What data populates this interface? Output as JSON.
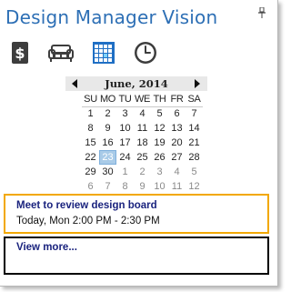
{
  "app": {
    "title": "Design Manager Vision"
  },
  "toolbar": {
    "buttons": [
      {
        "icon": "dollar-icon"
      },
      {
        "icon": "sofa-icon"
      },
      {
        "icon": "calendar-grid-icon"
      },
      {
        "icon": "clock-icon"
      }
    ]
  },
  "calendar": {
    "month_label": "June, 2014",
    "weekdays": [
      "SU",
      "MO",
      "TU",
      "WE",
      "TH",
      "FR",
      "SA"
    ],
    "selected_day": 23,
    "weeks": [
      [
        [
          "1",
          false
        ],
        [
          "2",
          false
        ],
        [
          "3",
          false
        ],
        [
          "4",
          false
        ],
        [
          "5",
          false
        ],
        [
          "6",
          false
        ],
        [
          "7",
          false
        ]
      ],
      [
        [
          "8",
          false
        ],
        [
          "9",
          false
        ],
        [
          "10",
          false
        ],
        [
          "11",
          false
        ],
        [
          "12",
          false
        ],
        [
          "13",
          false
        ],
        [
          "14",
          false
        ]
      ],
      [
        [
          "15",
          false
        ],
        [
          "16",
          false
        ],
        [
          "17",
          false
        ],
        [
          "18",
          false
        ],
        [
          "19",
          false
        ],
        [
          "20",
          false
        ],
        [
          "21",
          false
        ]
      ],
      [
        [
          "22",
          false
        ],
        [
          "23",
          false
        ],
        [
          "24",
          false
        ],
        [
          "25",
          false
        ],
        [
          "26",
          false
        ],
        [
          "27",
          false
        ],
        [
          "28",
          false
        ]
      ],
      [
        [
          "29",
          false
        ],
        [
          "30",
          false
        ],
        [
          "1",
          true
        ],
        [
          "2",
          true
        ],
        [
          "3",
          true
        ],
        [
          "4",
          true
        ],
        [
          "5",
          true
        ]
      ],
      [
        [
          "6",
          true
        ],
        [
          "7",
          true
        ],
        [
          "8",
          true
        ],
        [
          "9",
          true
        ],
        [
          "10",
          true
        ],
        [
          "11",
          true
        ],
        [
          "12",
          true
        ]
      ]
    ]
  },
  "appointment": {
    "title": "Meet to review design board",
    "time": "Today, Mon 2:00 PM - 2:30 PM"
  },
  "view_more": {
    "label": "View more..."
  },
  "colors": {
    "title": "#2d6fb5",
    "accent_border": "#f2a800",
    "today_highlight": "#a9cbe8",
    "link": "#1a237e"
  }
}
